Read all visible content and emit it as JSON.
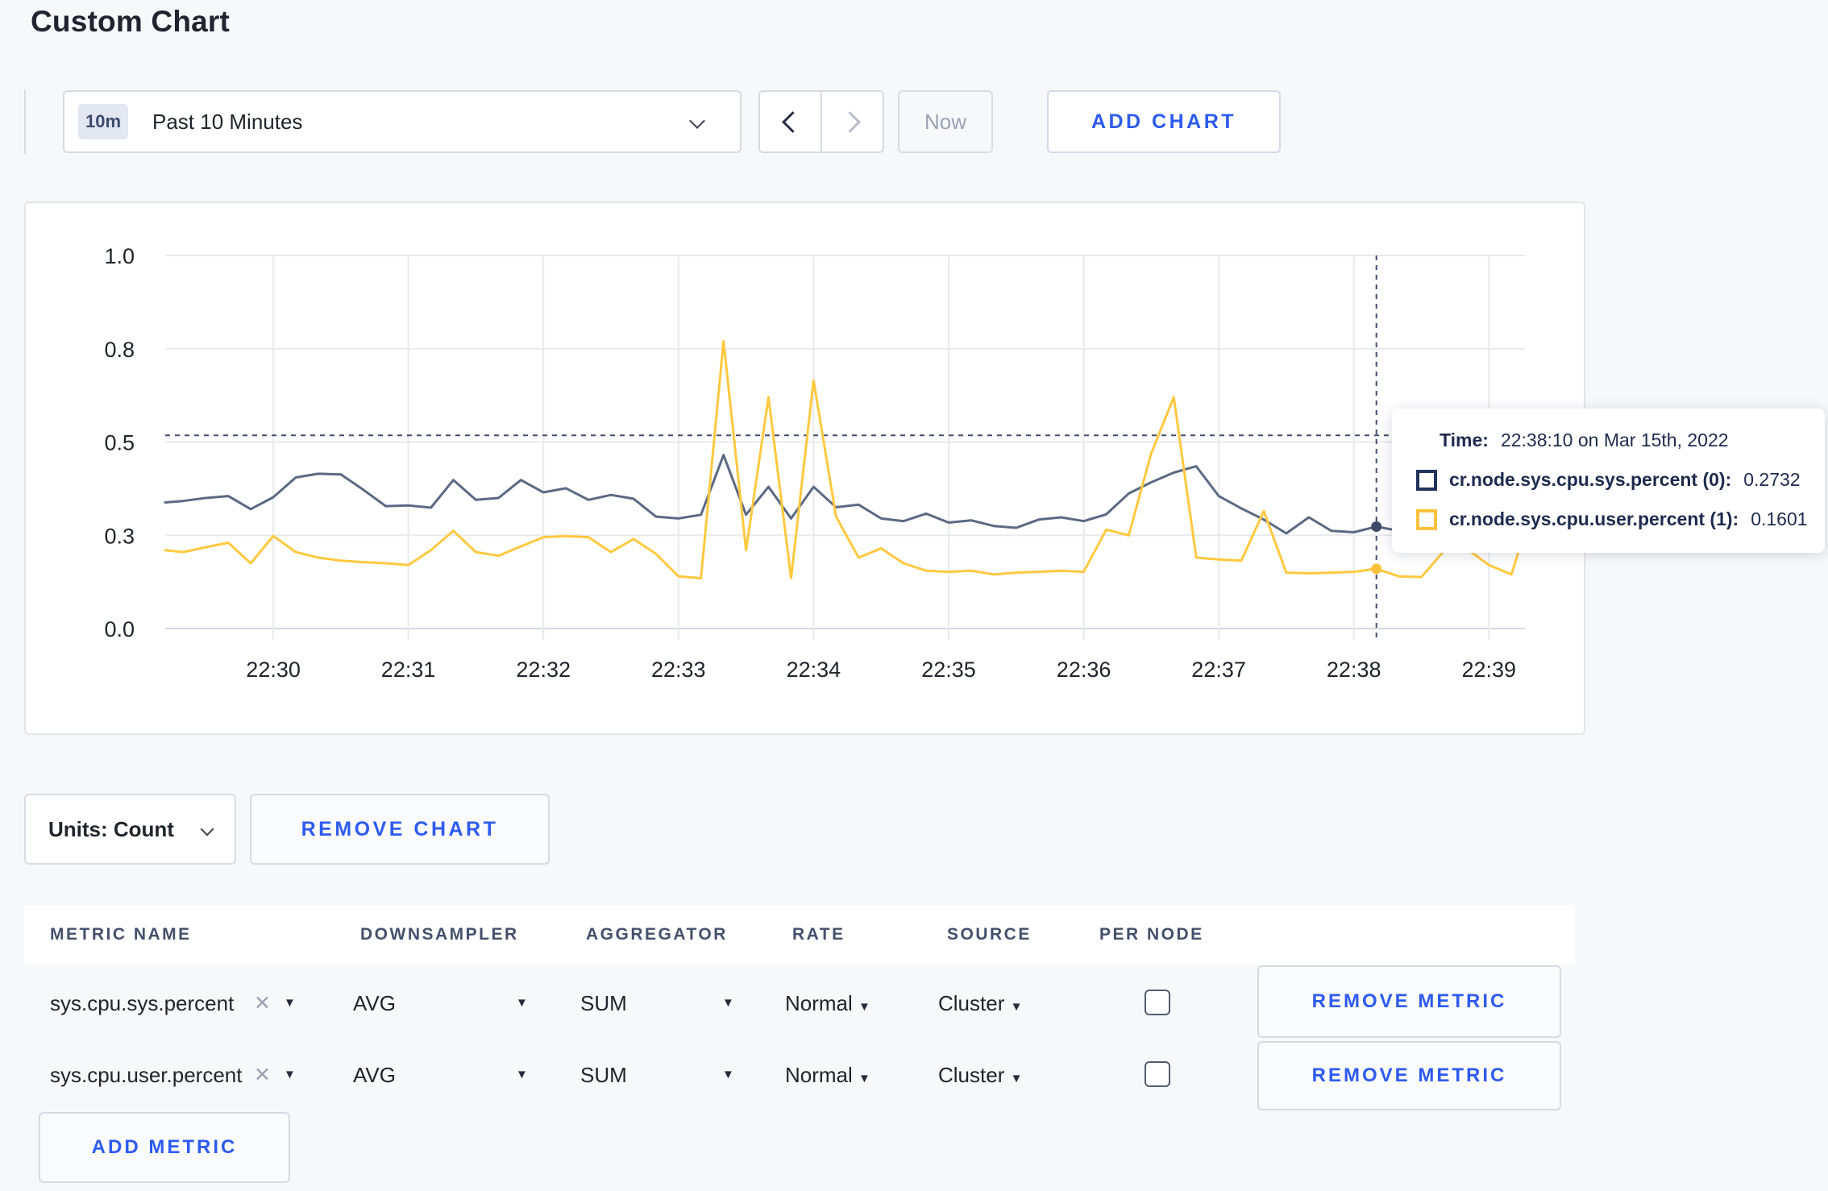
{
  "page": {
    "title": "Custom Chart",
    "background": "#f7f8fa",
    "accent_blue": "#2e5bf0"
  },
  "toolbar": {
    "time_badge": "10m",
    "time_label": "Past 10 Minutes",
    "prev_icon": "chevron-left",
    "next_icon": "chevron-right",
    "now": "Now",
    "add_chart": "ADD CHART"
  },
  "chart_data": {
    "type": "line",
    "title": "",
    "xlabel": "",
    "ylabel": "",
    "x_unit": "seconds after 22:00 (1800 = 22:30:00)",
    "x_domain": [
      1752,
      2356
    ],
    "y_domain": [
      0,
      1
    ],
    "grid": true,
    "legend_position": "none",
    "y_ticks": [
      {
        "v": 0,
        "label": "0.0"
      },
      {
        "v": 0.25,
        "label": "0.3"
      },
      {
        "v": 0.5,
        "label": "0.5"
      },
      {
        "v": 0.75,
        "label": "0.8"
      },
      {
        "v": 1,
        "label": "1.0"
      }
    ],
    "x_ticks": [
      {
        "v": 1800,
        "label": "22:30"
      },
      {
        "v": 1860,
        "label": "22:31"
      },
      {
        "v": 1920,
        "label": "22:32"
      },
      {
        "v": 1980,
        "label": "22:33"
      },
      {
        "v": 2040,
        "label": "22:34"
      },
      {
        "v": 2100,
        "label": "22:35"
      },
      {
        "v": 2160,
        "label": "22:36"
      },
      {
        "v": 2220,
        "label": "22:37"
      },
      {
        "v": 2280,
        "label": "22:38"
      },
      {
        "v": 2340,
        "label": "22:39"
      }
    ],
    "crosshair": {
      "t": 2290,
      "cursor_value": 0.518
    },
    "series": [
      {
        "id": "sys",
        "name": "cr.node.sys.cpu.sys.percent (0)",
        "color": "#5b6983",
        "dot_color": "#3d4a66",
        "points": [
          [
            1752,
            0.338
          ],
          [
            1760,
            0.342
          ],
          [
            1770,
            0.35
          ],
          [
            1780,
            0.355
          ],
          [
            1790,
            0.32
          ],
          [
            1800,
            0.352
          ],
          [
            1810,
            0.405
          ],
          [
            1820,
            0.415
          ],
          [
            1830,
            0.413
          ],
          [
            1840,
            0.372
          ],
          [
            1850,
            0.328
          ],
          [
            1860,
            0.33
          ],
          [
            1870,
            0.324
          ],
          [
            1880,
            0.398
          ],
          [
            1890,
            0.345
          ],
          [
            1900,
            0.35
          ],
          [
            1910,
            0.398
          ],
          [
            1920,
            0.365
          ],
          [
            1930,
            0.376
          ],
          [
            1940,
            0.345
          ],
          [
            1950,
            0.358
          ],
          [
            1960,
            0.348
          ],
          [
            1970,
            0.3
          ],
          [
            1980,
            0.295
          ],
          [
            1990,
            0.305
          ],
          [
            2000,
            0.465
          ],
          [
            2010,
            0.305
          ],
          [
            2020,
            0.38
          ],
          [
            2030,
            0.295
          ],
          [
            2040,
            0.38
          ],
          [
            2050,
            0.325
          ],
          [
            2060,
            0.332
          ],
          [
            2070,
            0.295
          ],
          [
            2080,
            0.288
          ],
          [
            2090,
            0.308
          ],
          [
            2100,
            0.284
          ],
          [
            2110,
            0.29
          ],
          [
            2120,
            0.275
          ],
          [
            2130,
            0.27
          ],
          [
            2140,
            0.292
          ],
          [
            2150,
            0.298
          ],
          [
            2160,
            0.288
          ],
          [
            2170,
            0.306
          ],
          [
            2180,
            0.362
          ],
          [
            2190,
            0.392
          ],
          [
            2200,
            0.418
          ],
          [
            2210,
            0.435
          ],
          [
            2220,
            0.355
          ],
          [
            2230,
            0.322
          ],
          [
            2240,
            0.292
          ],
          [
            2250,
            0.255
          ],
          [
            2260,
            0.298
          ],
          [
            2270,
            0.262
          ],
          [
            2280,
            0.258
          ],
          [
            2290,
            0.2732
          ],
          [
            2300,
            0.262
          ],
          [
            2310,
            0.295
          ],
          [
            2320,
            0.308
          ],
          [
            2330,
            0.295
          ],
          [
            2340,
            0.3
          ],
          [
            2350,
            0.318
          ],
          [
            2356,
            0.328
          ]
        ]
      },
      {
        "id": "user",
        "name": "cr.node.sys.cpu.user.percent (1)",
        "color": "#ffc93f",
        "dot_color": "#ffc23c",
        "points": [
          [
            1752,
            0.21
          ],
          [
            1760,
            0.205
          ],
          [
            1770,
            0.218
          ],
          [
            1780,
            0.23
          ],
          [
            1790,
            0.175
          ],
          [
            1800,
            0.248
          ],
          [
            1810,
            0.205
          ],
          [
            1820,
            0.19
          ],
          [
            1830,
            0.182
          ],
          [
            1840,
            0.178
          ],
          [
            1850,
            0.175
          ],
          [
            1860,
            0.17
          ],
          [
            1870,
            0.21
          ],
          [
            1880,
            0.262
          ],
          [
            1890,
            0.205
          ],
          [
            1900,
            0.195
          ],
          [
            1910,
            0.22
          ],
          [
            1920,
            0.245
          ],
          [
            1930,
            0.248
          ],
          [
            1940,
            0.245
          ],
          [
            1950,
            0.205
          ],
          [
            1960,
            0.24
          ],
          [
            1970,
            0.2
          ],
          [
            1980,
            0.14
          ],
          [
            1990,
            0.135
          ],
          [
            2000,
            0.77
          ],
          [
            2010,
            0.21
          ],
          [
            2020,
            0.62
          ],
          [
            2030,
            0.135
          ],
          [
            2040,
            0.665
          ],
          [
            2050,
            0.3
          ],
          [
            2060,
            0.19
          ],
          [
            2070,
            0.215
          ],
          [
            2080,
            0.175
          ],
          [
            2090,
            0.155
          ],
          [
            2100,
            0.152
          ],
          [
            2110,
            0.155
          ],
          [
            2120,
            0.145
          ],
          [
            2130,
            0.15
          ],
          [
            2140,
            0.152
          ],
          [
            2150,
            0.155
          ],
          [
            2160,
            0.152
          ],
          [
            2170,
            0.265
          ],
          [
            2180,
            0.25
          ],
          [
            2190,
            0.47
          ],
          [
            2200,
            0.62
          ],
          [
            2210,
            0.19
          ],
          [
            2220,
            0.185
          ],
          [
            2230,
            0.182
          ],
          [
            2240,
            0.315
          ],
          [
            2250,
            0.15
          ],
          [
            2260,
            0.148
          ],
          [
            2270,
            0.15
          ],
          [
            2280,
            0.152
          ],
          [
            2290,
            0.1601
          ],
          [
            2300,
            0.14
          ],
          [
            2310,
            0.138
          ],
          [
            2320,
            0.208
          ],
          [
            2330,
            0.215
          ],
          [
            2340,
            0.17
          ],
          [
            2350,
            0.145
          ],
          [
            2356,
            0.26
          ]
        ]
      }
    ]
  },
  "tooltip": {
    "time_label": "Time:",
    "time_value": "22:38:10 on Mar 15th, 2022",
    "rows": [
      {
        "swatch": "#22335a",
        "label": "cr.node.sys.cpu.sys.percent (0):",
        "value": "0.2732"
      },
      {
        "swatch": "#ffc23c",
        "label": "cr.node.sys.cpu.user.percent (1):",
        "value": "0.1601"
      }
    ]
  },
  "units_bar": {
    "units": "Units: Count",
    "remove_chart": "REMOVE CHART"
  },
  "metrics_table": {
    "headers": [
      "METRIC NAME",
      "DOWNSAMPLER",
      "AGGREGATOR",
      "RATE",
      "SOURCE",
      "PER NODE"
    ],
    "close_icon": "✕",
    "caret_icon": "▼",
    "rows": [
      {
        "metric": "sys.cpu.sys.percent",
        "downsampler": "AVG",
        "aggregator": "SUM",
        "rate": "Normal",
        "source": "Cluster",
        "per_node_checked": false,
        "remove": "REMOVE METRIC"
      },
      {
        "metric": "sys.cpu.user.percent",
        "downsampler": "AVG",
        "aggregator": "SUM",
        "rate": "Normal",
        "source": "Cluster",
        "per_node_checked": false,
        "remove": "REMOVE METRIC"
      }
    ],
    "add_metric": "ADD METRIC"
  }
}
